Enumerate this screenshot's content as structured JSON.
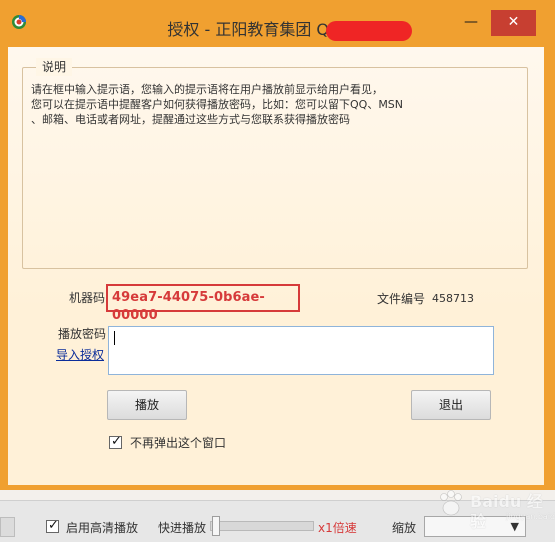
{
  "window": {
    "title": "授权 - 正阳教育集团 QQ：",
    "minimize_label": "—",
    "close_label": "✕"
  },
  "group": {
    "title": "说明",
    "lines": [
      "请在框中输入提示语，您输入的提示语将在用户播放前显示给用户看见，",
      "您可以在提示语中提醒客户如何获得播放密码，比如：您可以留下QQ、MSN",
      "、邮箱、电话或者网址，提醒通过这些方式与您联系获得播放密码"
    ]
  },
  "machine": {
    "label": "机器码",
    "value": "49ea7-44075-0b6ae-00000"
  },
  "file": {
    "label": "文件编号",
    "value": "458713"
  },
  "password": {
    "label": "播放密码",
    "value": "",
    "import_link": "导入授权"
  },
  "buttons": {
    "play": "播放",
    "exit": "退出"
  },
  "options": {
    "no_popup_label": "不再弹出这个窗口",
    "no_popup_checked": true
  },
  "bottom": {
    "hd_label": "启用高清播放",
    "hd_checked": true,
    "fast_forward_label": "快进播放",
    "speed_label": "x1倍速",
    "zoom_label": "缩放",
    "zoom_value": ""
  },
  "watermark": {
    "brand": "Baidu 经验",
    "sub": "jingyan.baidu.com"
  },
  "colors": {
    "window_frame": "#f0a030",
    "close_button": "#c73f31",
    "highlight_red": "#d63a3a",
    "link_blue": "#0b2d9a"
  }
}
